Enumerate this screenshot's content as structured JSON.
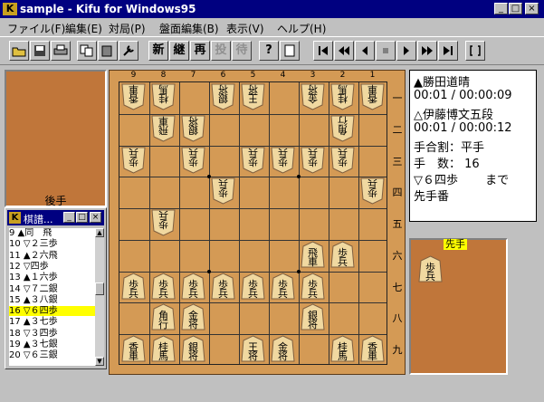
{
  "window": {
    "title": "sample - Kifu for Windows95",
    "app_icon": "K"
  },
  "menu": [
    "ファイル(F)",
    "編集(E)",
    "対局(P)",
    "盤面編集(B)",
    "表示(V)",
    "ヘルプ(H)"
  ],
  "toolbar": {
    "new_label": "新",
    "continue_label": "継",
    "replay_label": "再",
    "resign_label": "投",
    "pass_label": "待"
  },
  "board": {
    "col_numbers": [
      "9",
      "8",
      "7",
      "6",
      "5",
      "4",
      "3",
      "2",
      "1"
    ],
    "row_numbers": [
      "一",
      "二",
      "三",
      "四",
      "五",
      "六",
      "七",
      "八",
      "九"
    ]
  },
  "pieces": [
    {
      "char": "香車",
      "side": "gote",
      "col": 9,
      "row": 1
    },
    {
      "char": "桂馬",
      "side": "gote",
      "col": 8,
      "row": 1
    },
    {
      "char": "王将",
      "side": "gote",
      "col": 5,
      "row": 1
    },
    {
      "char": "銀将",
      "side": "gote",
      "col": 6,
      "row": 1
    },
    {
      "char": "金将",
      "side": "gote",
      "col": 3,
      "row": 1
    },
    {
      "char": "桂馬",
      "side": "gote",
      "col": 2,
      "row": 1
    },
    {
      "char": "香車",
      "side": "gote",
      "col": 1,
      "row": 1
    },
    {
      "char": "飛車",
      "side": "gote",
      "col": 8,
      "row": 2
    },
    {
      "char": "銀将",
      "side": "gote",
      "col": 7,
      "row": 2
    },
    {
      "char": "角行",
      "side": "gote",
      "col": 2,
      "row": 2
    },
    {
      "char": "歩兵",
      "side": "gote",
      "col": 9,
      "row": 3
    },
    {
      "char": "歩兵",
      "side": "gote",
      "col": 7,
      "row": 3
    },
    {
      "char": "歩兵",
      "side": "gote",
      "col": 5,
      "row": 3
    },
    {
      "char": "歩兵",
      "side": "gote",
      "col": 4,
      "row": 3
    },
    {
      "char": "歩兵",
      "side": "gote",
      "col": 3,
      "row": 3
    },
    {
      "char": "歩兵",
      "side": "gote",
      "col": 2,
      "row": 3
    },
    {
      "char": "歩兵",
      "side": "gote",
      "col": 6,
      "row": 4
    },
    {
      "char": "歩兵",
      "side": "gote",
      "col": 1,
      "row": 4
    },
    {
      "char": "歩兵",
      "side": "gote",
      "col": 8,
      "row": 5
    },
    {
      "char": "飛車",
      "side": "sente",
      "col": 3,
      "row": 6
    },
    {
      "char": "歩兵",
      "side": "sente",
      "col": 2,
      "row": 6
    },
    {
      "char": "歩兵",
      "side": "sente",
      "col": 9,
      "row": 7
    },
    {
      "char": "歩兵",
      "side": "sente",
      "col": 8,
      "row": 7
    },
    {
      "char": "歩兵",
      "side": "sente",
      "col": 7,
      "row": 7
    },
    {
      "char": "歩兵",
      "side": "sente",
      "col": 6,
      "row": 7
    },
    {
      "char": "歩兵",
      "side": "sente",
      "col": 5,
      "row": 7
    },
    {
      "char": "歩兵",
      "side": "sente",
      "col": 4,
      "row": 7
    },
    {
      "char": "歩兵",
      "side": "sente",
      "col": 3,
      "row": 7
    },
    {
      "char": "角行",
      "side": "sente",
      "col": 8,
      "row": 8
    },
    {
      "char": "金将",
      "side": "sente",
      "col": 7,
      "row": 8
    },
    {
      "char": "銀将",
      "side": "sente",
      "col": 3,
      "row": 8
    },
    {
      "char": "香車",
      "side": "sente",
      "col": 9,
      "row": 9
    },
    {
      "char": "桂馬",
      "side": "sente",
      "col": 8,
      "row": 9
    },
    {
      "char": "銀将",
      "side": "sente",
      "col": 7,
      "row": 9
    },
    {
      "char": "王将",
      "side": "sente",
      "col": 5,
      "row": 9
    },
    {
      "char": "金将",
      "side": "sente",
      "col": 4,
      "row": 9
    },
    {
      "char": "桂馬",
      "side": "sente",
      "col": 2,
      "row": 9
    },
    {
      "char": "香車",
      "side": "sente",
      "col": 1,
      "row": 9
    }
  ],
  "gote_label": "後手",
  "sente_label": "先手",
  "sente_hand_piece": "歩兵",
  "info": {
    "sente_name": "▲勝田道晴",
    "sente_time": "00:01 / 00:00:09",
    "gote_name": "△伊藤博文五段",
    "gote_time": "00:01 / 00:00:12",
    "handicap": "手合割：平手",
    "move_count": "手　数： 16",
    "last_move": "▽６四歩　　 まで",
    "turn": "先手番"
  },
  "kifu_window": {
    "title": "棋譜...",
    "icon": "K",
    "moves": [
      {
        "text": "  9 ▲同　飛",
        "selected": false
      },
      {
        "text": " 10 ▽２三歩",
        "selected": false
      },
      {
        "text": " 11 ▲２六飛",
        "selected": false
      },
      {
        "text": " 12 ▽四歩",
        "selected": false
      },
      {
        "text": " 13 ▲１六歩",
        "selected": false
      },
      {
        "text": " 14 ▽７二銀",
        "selected": false
      },
      {
        "text": " 15 ▲３八銀",
        "selected": false
      },
      {
        "text": " 16 ▽６四歩",
        "selected": true
      },
      {
        "text": " 17 ▲３七歩",
        "selected": false
      },
      {
        "text": " 18 ▽３四歩",
        "selected": false
      },
      {
        "text": " 19 ▲３七銀",
        "selected": false
      },
      {
        "text": " 20 ▽６三銀",
        "selected": false
      }
    ]
  }
}
